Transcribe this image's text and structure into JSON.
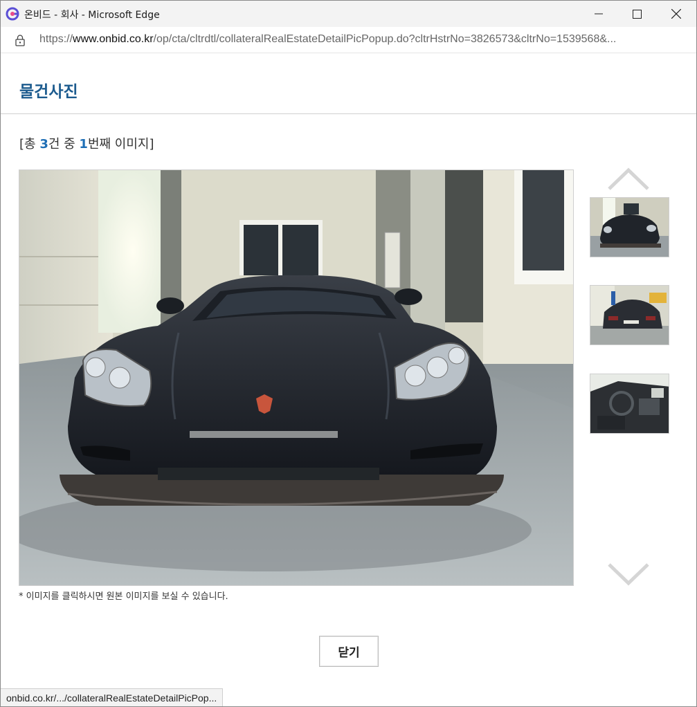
{
  "window": {
    "title": "온비드 - 회사 - Microsoft Edge",
    "controls": {
      "minimize": "minimize-icon",
      "maximize": "maximize-icon",
      "close": "close-icon"
    }
  },
  "address": {
    "scheme": "https://",
    "host": "www.onbid.co.kr",
    "path": "/op/cta/cltrdtl/collateralRealEstateDetailPicPopup.do?cltrHstrNo=3826573&cltrNo=1539568&..."
  },
  "page": {
    "title": "물건사진",
    "counter": {
      "prefix": "[총 ",
      "total": "3",
      "middle": "건 중 ",
      "current": "1",
      "suffix": "번째 이미지]"
    },
    "hint": "* 이미지를 클릭하시면 원본 이미지를 보실 수 있습니다.",
    "close_label": "닫기"
  },
  "thumbnails": [
    {
      "subject": "car-front"
    },
    {
      "subject": "car-rear"
    },
    {
      "subject": "car-interior"
    }
  ],
  "status_text": "onbid.co.kr/.../collateralRealEstateDetailPicPop...",
  "colors": {
    "accent": "#1c5b8e",
    "counter_num": "#1f6fb6"
  }
}
